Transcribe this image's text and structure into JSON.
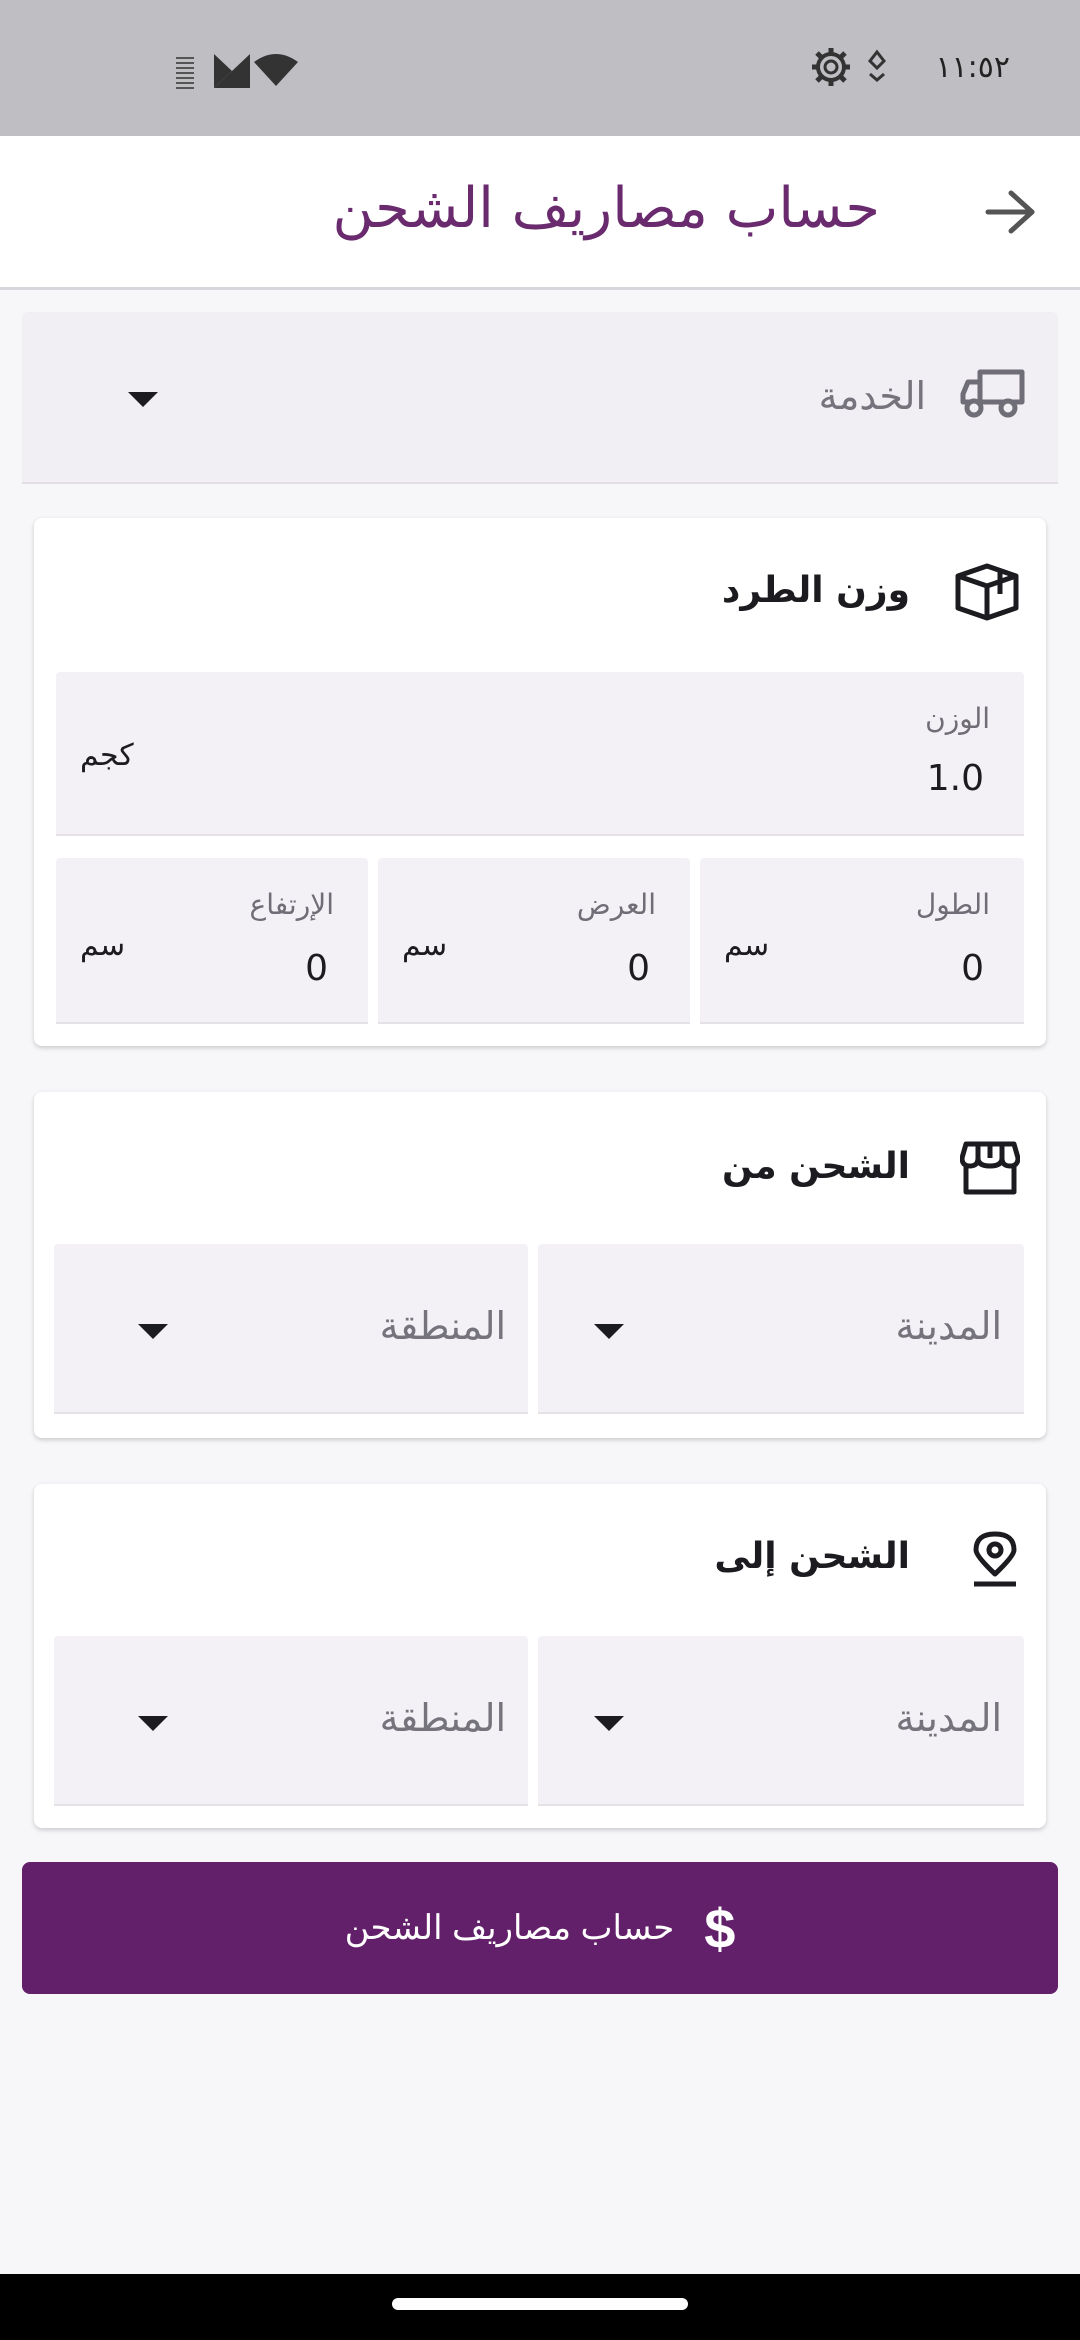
{
  "status_bar": {
    "time": "١١:٥٢",
    "icons": [
      "settings-gear-icon",
      "location-drop-icon",
      "wifi-icon",
      "signal-icon",
      "battery-icon"
    ]
  },
  "app_bar": {
    "title": "حساب مصاريف الشحن",
    "back_icon": "arrow-back-icon"
  },
  "service": {
    "label": "الخدمة",
    "icon": "truck-icon"
  },
  "parcel": {
    "title": "وزن الطرد",
    "icon": "package-icon",
    "weight": {
      "label": "الوزن",
      "value": "1.0",
      "unit": "كجم"
    },
    "length": {
      "label": "الطول",
      "value": "0",
      "unit": "سم"
    },
    "width": {
      "label": "العرض",
      "value": "0",
      "unit": "سم"
    },
    "height": {
      "label": "الإرتفاع",
      "value": "0",
      "unit": "سم"
    }
  },
  "ship_from": {
    "title": "الشحن من",
    "icon": "store-icon",
    "city_label": "المدينة",
    "region_label": "المنطقة"
  },
  "ship_to": {
    "title": "الشحن إلى",
    "icon": "location-pin-icon",
    "city_label": "المدينة",
    "region_label": "المنطقة"
  },
  "calculate_button": {
    "label": "حساب مصاريف الشحن",
    "icon": "dollar-icon",
    "symbol": "$"
  },
  "colors": {
    "primary": "#63206a",
    "title": "#6a2a6e",
    "field_bg": "#f3f1f5",
    "status_bar": "#bfbec2"
  }
}
